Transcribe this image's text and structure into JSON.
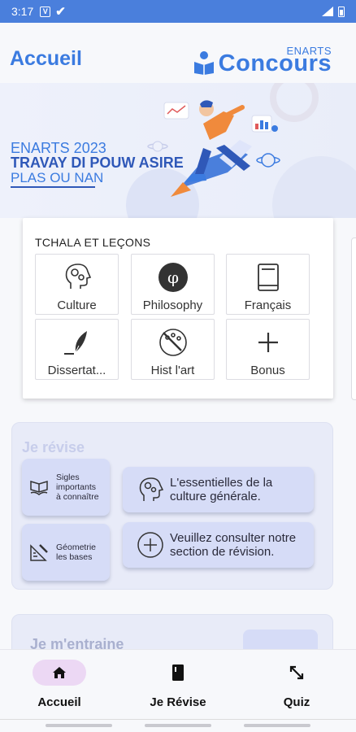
{
  "status_bar": {
    "time": "3:17",
    "notification_icons": [
      "v-icon",
      "check-icon"
    ],
    "right_icons": [
      "signal-icon",
      "battery-icon"
    ]
  },
  "header": {
    "title": "Accueil",
    "logo_small": "ENARTS",
    "logo_main": "Concours"
  },
  "banner": {
    "line1": "ENARTS 2023",
    "line2": "TRAVAY DI POUW ASIRE",
    "line3": "PLAS OU NAN"
  },
  "lessons": {
    "title": "TCHALA ET LEÇONS",
    "tiles": [
      {
        "label": "Culture",
        "icon": "head-gears-icon"
      },
      {
        "label": "Philosophy",
        "icon": "phi-icon"
      },
      {
        "label": "Français",
        "icon": "book-icon"
      },
      {
        "label": "Dissertat...",
        "icon": "feather-pen-icon"
      },
      {
        "label": "Hist l'art",
        "icon": "palette-icon"
      },
      {
        "label": "Bonus",
        "icon": "plus-icon"
      }
    ]
  },
  "revise": {
    "title": "Je révise",
    "small_cards": [
      {
        "label_lines": [
          "Sigles",
          "importants",
          "à connaître"
        ],
        "icon": "open-book-hand-icon"
      },
      {
        "label_lines": [
          "Géometrie",
          "les bases"
        ],
        "icon": "ruler-pencil-icon"
      }
    ],
    "wide_cards": [
      {
        "label_lines": [
          "L'essentielles de la",
          "culture générale."
        ],
        "icon": "head-gears-icon"
      },
      {
        "label_lines": [
          "Veuillez consulter notre",
          "section de révision."
        ],
        "icon": "plus-circle-icon"
      }
    ]
  },
  "train": {
    "title": "Je m'entraine"
  },
  "bottom_nav": [
    {
      "label": "Accueil",
      "icon": "home-icon",
      "active": true
    },
    {
      "label": "Je Révise",
      "icon": "book-icon",
      "active": false
    },
    {
      "label": "Quiz",
      "icon": "arrows-diagonal-icon",
      "active": false
    }
  ],
  "colors": {
    "primary": "#3b7be0",
    "status_bar": "#4a7fdc",
    "card_bg": "#d6dcf7",
    "section_bg": "#e8ebf8",
    "active_nav": "#ecd8f4"
  }
}
